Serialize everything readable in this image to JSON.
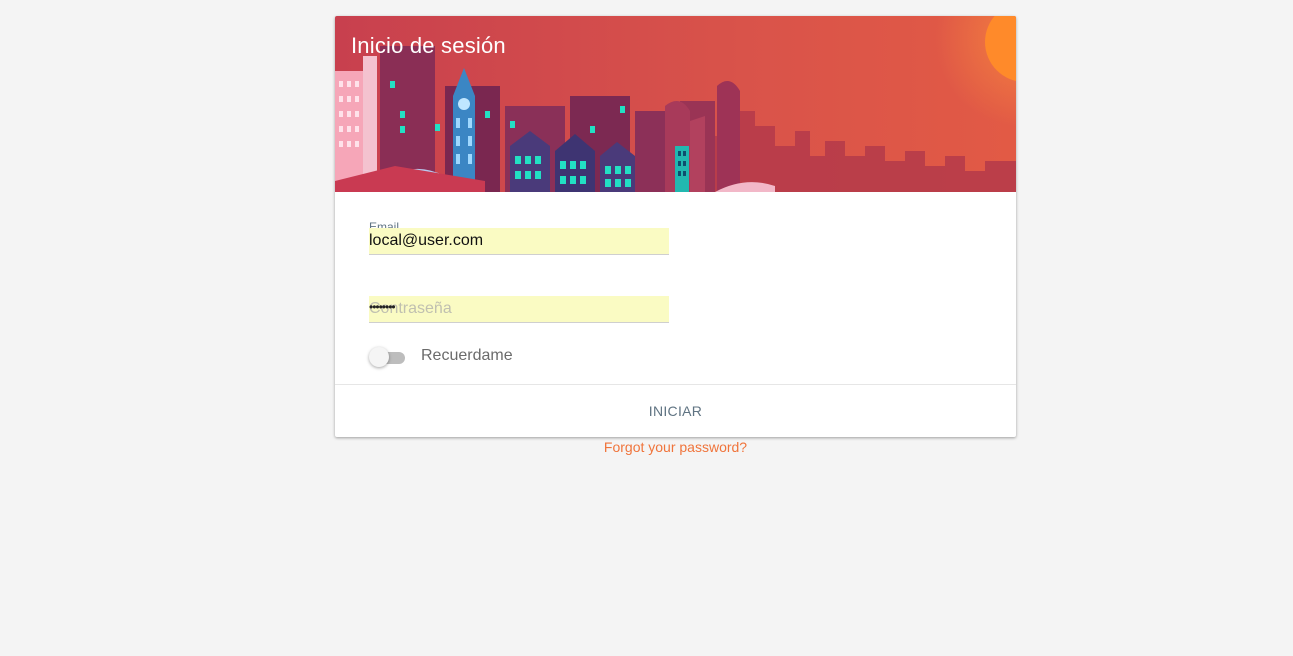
{
  "login": {
    "title": "Inicio de sesión",
    "email_label": "Email",
    "email_value": "local@user.com",
    "password_placeholder": "Contraseña",
    "password_mask": "••••••••",
    "remember_label": "Recuerdame",
    "remember_checked": false,
    "submit_label": "INICIAR",
    "forgot_link": "Forgot your password?"
  },
  "colors": {
    "banner_bg": "#d9534a",
    "accent": "#f0743b",
    "autofill": "#fafbc3",
    "label": "#5f7382"
  }
}
